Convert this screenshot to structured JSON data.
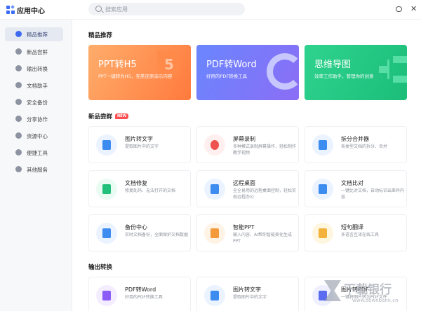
{
  "header": {
    "app_title": "应用中心",
    "search_placeholder": "搜索应用"
  },
  "sidebar": {
    "items": [
      {
        "label": "精品推荐",
        "icon": "diamond-icon",
        "active": true
      },
      {
        "label": "新品尝鲜",
        "icon": "apple-icon"
      },
      {
        "label": "输出转换",
        "icon": "convert-icon"
      },
      {
        "label": "文档助手",
        "icon": "document-icon"
      },
      {
        "label": "安全备份",
        "icon": "shield-icon"
      },
      {
        "label": "分享协作",
        "icon": "share-icon"
      },
      {
        "label": "资源中心",
        "icon": "resource-icon"
      },
      {
        "label": "便捷工具",
        "icon": "lightning-icon"
      },
      {
        "label": "其他服务",
        "icon": "more-icon"
      }
    ]
  },
  "sections": {
    "featured": "精品推荐",
    "new": "新品尝鲜",
    "new_badge": "NEW",
    "output": "输出转换"
  },
  "banners": [
    {
      "title": "PPT转H5",
      "subtitle": "PPT一键转为H5，完美还原演示内容",
      "deco": "5"
    },
    {
      "title": "PDF转Word",
      "subtitle": "好用的PDF转换工具"
    },
    {
      "title": "思维导图",
      "subtitle": "效率工作助手，管理你的创意"
    }
  ],
  "cards": [
    {
      "title": "图片转文字",
      "desc": "提取图片中的文字",
      "icon": "image-to-text-icon",
      "color": "blue"
    },
    {
      "title": "屏幕录制",
      "desc": "多种模式录制屏幕操作，轻松制作教学视频",
      "icon": "screen-record-icon",
      "color": "red"
    },
    {
      "title": "拆分合并器",
      "desc": "各类型文档的拆分、合并",
      "icon": "split-merge-icon",
      "color": "blue"
    },
    {
      "title": "文档修复",
      "desc": "修复乱码、无法打开的文档",
      "icon": "doc-repair-icon",
      "color": "green"
    },
    {
      "title": "远程桌面",
      "desc": "全全易用的远程桌面控制，轻松实现远程办公",
      "icon": "remote-desktop-icon",
      "color": "blue"
    },
    {
      "title": "文档比对",
      "desc": "一键比对文档，自动标识出差异内容",
      "icon": "doc-compare-icon",
      "color": "blue"
    },
    {
      "title": "备份中心",
      "desc": "实时文档备份，全面保护文档数据",
      "icon": "backup-icon",
      "color": "blue"
    },
    {
      "title": "智能PPT",
      "desc": "输入内容，AI帮你智能美化生成PPT",
      "icon": "smart-ppt-icon",
      "color": "orange"
    },
    {
      "title": "短句翻译",
      "desc": "多语言互译在线工具",
      "icon": "translate-icon",
      "color": "yellow"
    },
    {
      "title": "PDF转Word",
      "desc": "好用的PDF转换工具",
      "icon": "pdf-to-word-icon",
      "color": "purple"
    },
    {
      "title": "图片转文字",
      "desc": "提取图片中的文字",
      "icon": "image-to-text-icon",
      "color": "blue"
    },
    {
      "title": "图片转PDF",
      "desc": "一键将图片转为PDF文件",
      "icon": "image-to-pdf-icon",
      "color": "indigo"
    }
  ],
  "watermark": {
    "text": "下载银行",
    "url": "www.downbank.cn"
  }
}
